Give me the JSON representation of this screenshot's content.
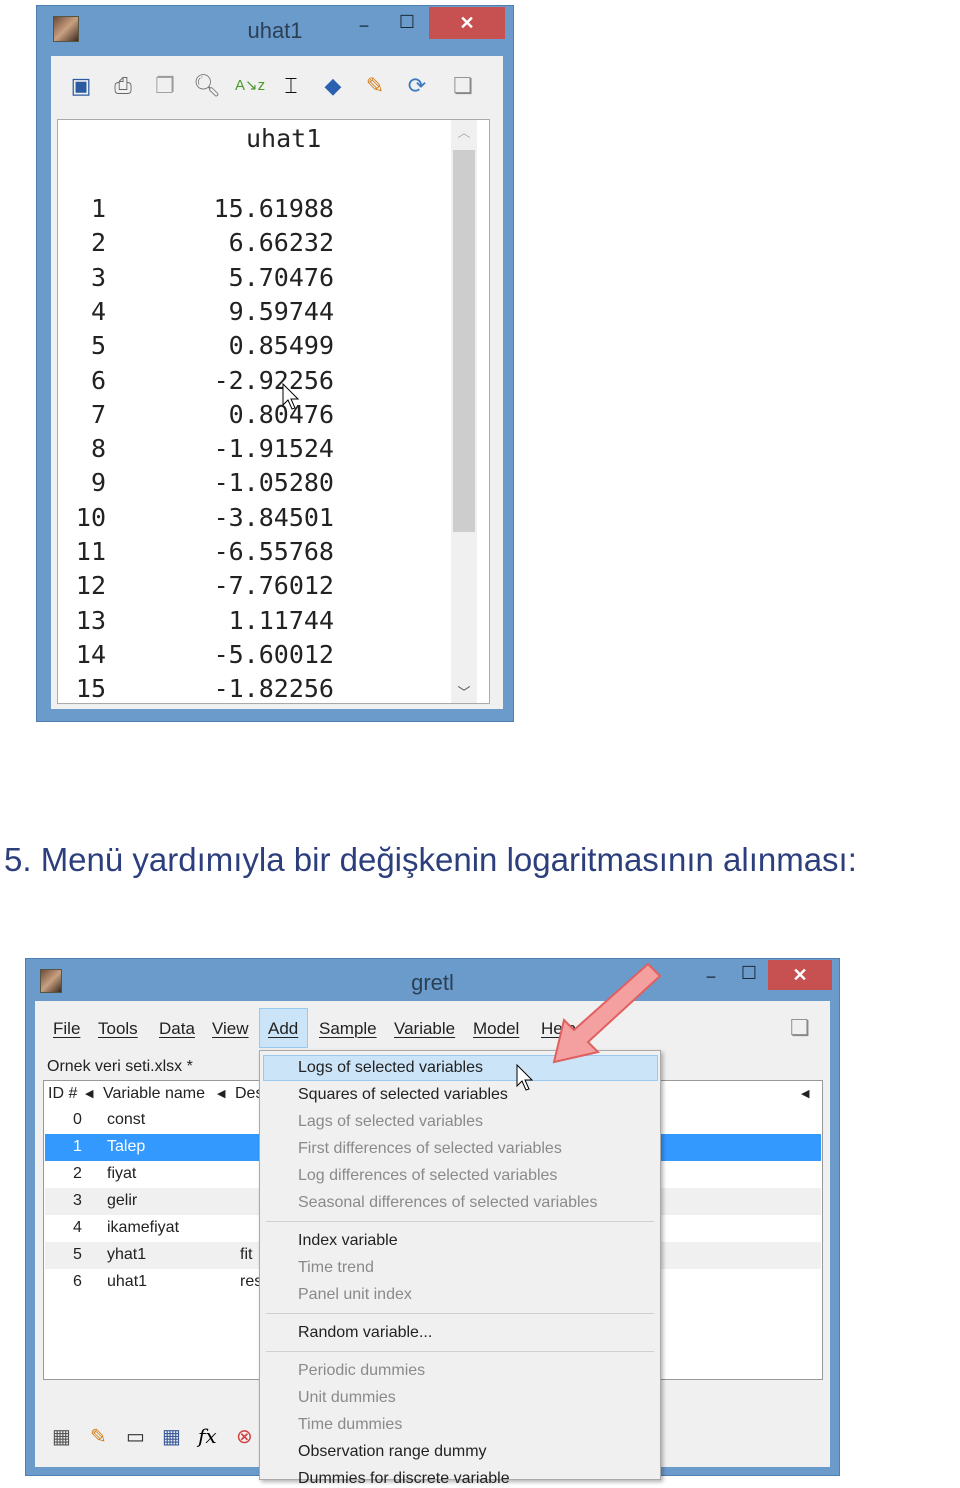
{
  "uhat_window": {
    "title": "uhat1",
    "minimize": "−",
    "maximize": "☐",
    "close": "✕",
    "toolbar": [
      "save-icon",
      "print-icon",
      "copy-icon",
      "search-icon",
      "sort-icon",
      "boxplot-icon",
      "plot-icon",
      "edit-icon",
      "refresh-icon",
      "windows-icon"
    ],
    "column_header": "uhat1",
    "rows": [
      {
        "n": "1",
        "v": "15.61988"
      },
      {
        "n": "2",
        "v": "6.66232"
      },
      {
        "n": "3",
        "v": "5.70476"
      },
      {
        "n": "4",
        "v": "9.59744"
      },
      {
        "n": "5",
        "v": "0.85499"
      },
      {
        "n": "6",
        "v": "-2.92256"
      },
      {
        "n": "7",
        "v": "0.80476"
      },
      {
        "n": "8",
        "v": "-1.91524"
      },
      {
        "n": "9",
        "v": "-1.05280"
      },
      {
        "n": "10",
        "v": "-3.84501"
      },
      {
        "n": "11",
        "v": "-6.55768"
      },
      {
        "n": "12",
        "v": "-7.76012"
      },
      {
        "n": "13",
        "v": "1.11744"
      },
      {
        "n": "14",
        "v": "-5.60012"
      },
      {
        "n": "15",
        "v": "-1.82256"
      }
    ]
  },
  "caption": "5. Menü yardımıyla bir değişkenin logaritmasının alınması:",
  "gretl_window": {
    "title": "gretl",
    "minimize": "−",
    "maximize": "☐",
    "close": "✕",
    "menubar": [
      "File",
      "Tools",
      "Data",
      "View",
      "Add",
      "Sample",
      "Variable",
      "Model",
      "Help"
    ],
    "dataset_label": "Ornek veri seti.xlsx *",
    "columns": [
      "ID #",
      "Variable name",
      "Des"
    ],
    "rows": [
      {
        "id": "0",
        "name": "const",
        "desc": ""
      },
      {
        "id": "1",
        "name": "Talep",
        "desc": ""
      },
      {
        "id": "2",
        "name": "fiyat",
        "desc": ""
      },
      {
        "id": "3",
        "name": "gelir",
        "desc": ""
      },
      {
        "id": "4",
        "name": "ikamefiyat",
        "desc": ""
      },
      {
        "id": "5",
        "name": "yhat1",
        "desc": "fit"
      },
      {
        "id": "6",
        "name": "uhat1",
        "desc": "res"
      }
    ],
    "selected_row": "1",
    "bottom_toolbar": [
      "calculator-icon",
      "script-icon",
      "console-icon",
      "session-icon",
      "function-icon",
      "help-icon"
    ],
    "fx_label": "fx",
    "add_menu": [
      {
        "label": "Logs of selected variables",
        "enabled": true,
        "highlighted": true
      },
      {
        "label": "Squares of selected variables",
        "enabled": true
      },
      {
        "label": "Lags of selected variables",
        "enabled": false
      },
      {
        "label": "First differences of selected variables",
        "enabled": false
      },
      {
        "label": "Log differences of selected variables",
        "enabled": false
      },
      {
        "label": "Seasonal differences of selected variables",
        "enabled": false
      },
      {
        "label": "Index variable",
        "enabled": true
      },
      {
        "label": "Time trend",
        "enabled": false
      },
      {
        "label": "Panel unit index",
        "enabled": false
      },
      {
        "label": "Random variable...",
        "enabled": true
      },
      {
        "label": "Periodic dummies",
        "enabled": false
      },
      {
        "label": "Unit dummies",
        "enabled": false
      },
      {
        "label": "Time dummies",
        "enabled": false
      },
      {
        "label": "Observation range dummy",
        "enabled": true
      },
      {
        "label": "Dummies for discrete variable",
        "enabled": true
      }
    ]
  },
  "colors": {
    "titlebar": "#6b9bcb",
    "close": "#c75050",
    "selection": "#3399ff",
    "menu_highlight": "#cce4f7",
    "arrow": "#f08080",
    "caption": "#2c3e7c"
  }
}
